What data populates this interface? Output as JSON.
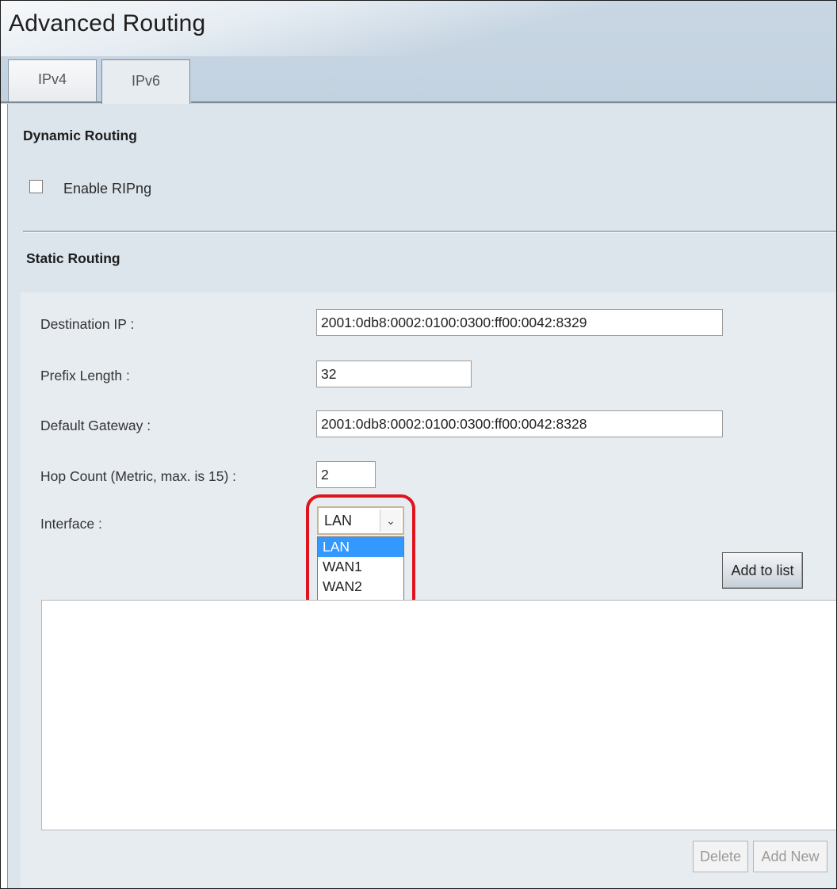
{
  "page": {
    "title": "Advanced Routing"
  },
  "tabs": [
    {
      "label": "IPv4",
      "active": false
    },
    {
      "label": "IPv6",
      "active": true
    }
  ],
  "dynamic_routing": {
    "heading": "Dynamic Routing",
    "enable_ripng_label": "Enable RIPng",
    "enable_ripng_checked": false
  },
  "static_routing": {
    "heading": "Static Routing",
    "destination_ip": {
      "label": "Destination IP :",
      "value": "2001:0db8:0002:0100:0300:ff00:0042:8329"
    },
    "prefix_length": {
      "label": "Prefix Length :",
      "value": "32"
    },
    "default_gateway": {
      "label": "Default Gateway :",
      "value": "2001:0db8:0002:0100:0300:ff00:0042:8328"
    },
    "hop_count": {
      "label": "Hop Count (Metric, max. is 15) :",
      "value": "2"
    },
    "interface": {
      "label": "Interface :",
      "selected": "LAN",
      "options": [
        "LAN",
        "WAN1",
        "WAN2"
      ]
    },
    "add_to_list_label": "Add to list",
    "delete_label": "Delete",
    "add_new_label": "Add New"
  },
  "colors": {
    "highlight_ring": "#e0141e",
    "selected_option": "#3399ff",
    "panel_background": "#dce4ec"
  }
}
